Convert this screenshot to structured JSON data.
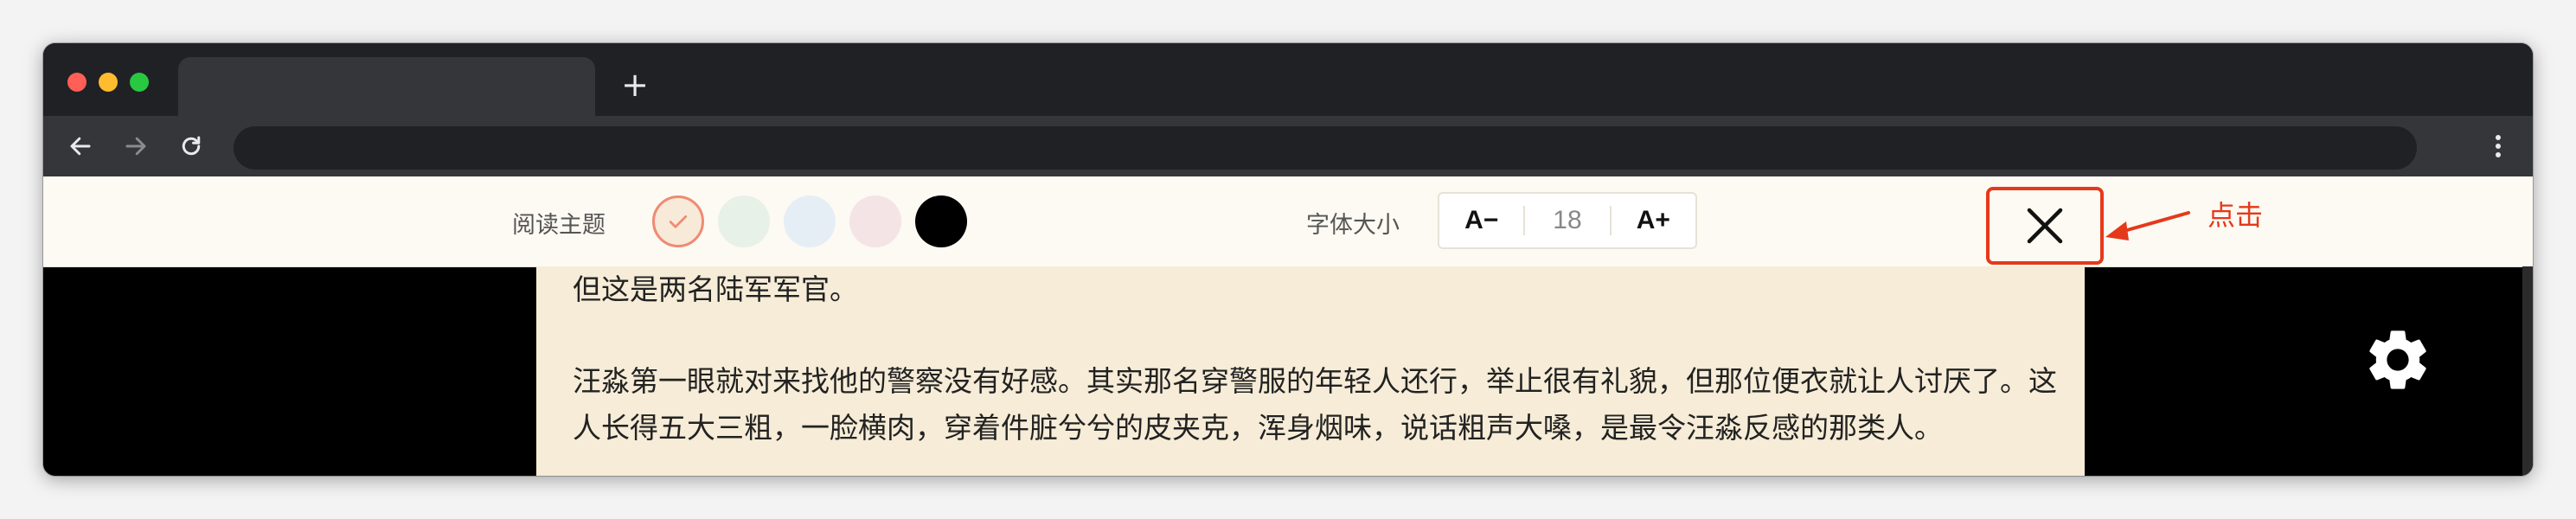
{
  "browser": {
    "new_tab_symbol": "+"
  },
  "reader_toolbar": {
    "theme_label": "阅读主题",
    "themes": [
      {
        "name": "warm",
        "color": "#f7ead9",
        "selected": true
      },
      {
        "name": "green",
        "color": "#e7f1e8",
        "selected": false
      },
      {
        "name": "blue",
        "color": "#e6eef5",
        "selected": false
      },
      {
        "name": "pink",
        "color": "#f4e4e6",
        "selected": false
      },
      {
        "name": "black",
        "color": "#000000",
        "selected": false
      }
    ],
    "font_label": "字体大小",
    "font_decrease_label": "A−",
    "font_size_value": "18",
    "font_increase_label": "A+"
  },
  "annotation": {
    "text": "点击",
    "color": "#e5391b"
  },
  "article": {
    "paragraphs": [
      "但这是两名陆军军官。",
      "汪淼第一眼就对来找他的警察没有好感。其实那名穿警服的年轻人还行，举止很有礼貌，但那位便衣就让人讨厌了。这人长得五大三粗，一脸横肉，穿着件脏兮兮的皮夹克，浑身烟味，说话粗声大嗓，是最令汪淼反感的那类人。"
    ],
    "background": "#f6ecd7"
  },
  "icons": {
    "back": "back-arrow-icon",
    "forward": "forward-arrow-icon",
    "reload": "reload-icon",
    "menu": "kebab-menu-icon",
    "close": "close-icon",
    "settings": "gear-icon",
    "check": "check-icon"
  }
}
